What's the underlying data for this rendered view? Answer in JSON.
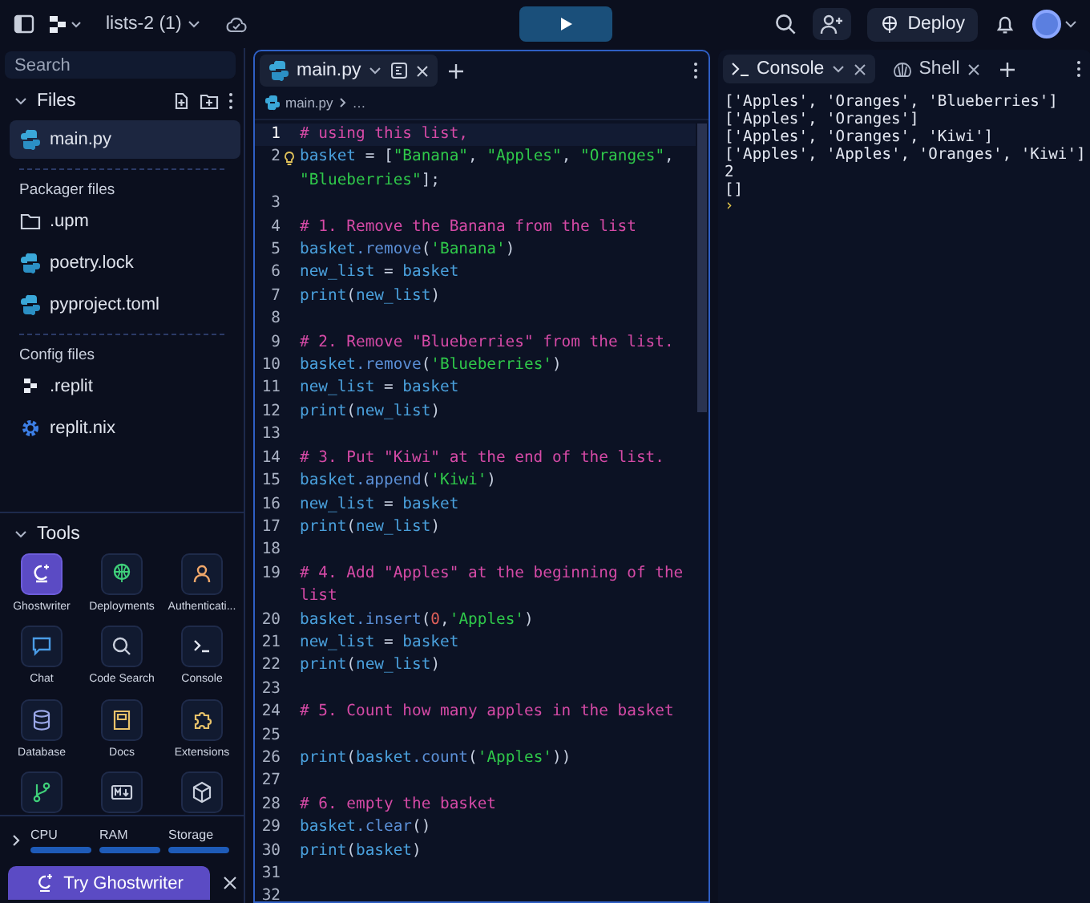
{
  "topbar": {
    "project": "lists-2 (1)",
    "deploy": "Deploy"
  },
  "sidebar": {
    "search": {
      "placeholder": "Search"
    },
    "files_title": "Files",
    "files": [
      {
        "name": "main.py",
        "kind": "python",
        "selected": true
      }
    ],
    "sections": [
      {
        "title": "Packager files",
        "items": [
          {
            "name": ".upm",
            "kind": "folder",
            "selected": false
          },
          {
            "name": "poetry.lock",
            "kind": "python",
            "selected": false
          },
          {
            "name": "pyproject.toml",
            "kind": "python",
            "selected": false
          }
        ]
      },
      {
        "title": "Config files",
        "items": [
          {
            "name": ".replit",
            "kind": "replit",
            "selected": false
          },
          {
            "name": "replit.nix",
            "kind": "gear",
            "selected": false
          }
        ]
      }
    ],
    "tools_title": "Tools",
    "tools": [
      {
        "label": "Ghostwriter",
        "kind": "ghostwriter",
        "selected": true
      },
      {
        "label": "Deployments",
        "kind": "deploy",
        "selected": false
      },
      {
        "label": "Authenticati...",
        "kind": "auth",
        "selected": false
      },
      {
        "label": "Chat",
        "kind": "chat",
        "selected": false
      },
      {
        "label": "Code Search",
        "kind": "search",
        "selected": false
      },
      {
        "label": "Console",
        "kind": "console",
        "selected": false
      },
      {
        "label": "Database",
        "kind": "database",
        "selected": false
      },
      {
        "label": "Docs",
        "kind": "docs",
        "selected": false
      },
      {
        "label": "Extensions",
        "kind": "extensions",
        "selected": false
      },
      {
        "kind": "git",
        "selected": false
      },
      {
        "kind": "markdown",
        "selected": false
      },
      {
        "kind": "package",
        "selected": false
      }
    ],
    "meters": [
      {
        "name": "CPU",
        "level": 1
      },
      {
        "name": "RAM",
        "level": 1
      },
      {
        "name": "Storage",
        "level": 1
      }
    ],
    "try_button": "Try Ghostwriter"
  },
  "editor": {
    "tab": "main.py",
    "breadcrumb": "main.py",
    "breadcrumb_more": "…",
    "lines": [
      {
        "number": "1",
        "current": true,
        "tokens": [
          {
            "kind": "comment",
            "text": "# using this list,"
          }
        ]
      },
      {
        "number": "2",
        "current": false,
        "tokens": [
          {
            "kind": "ident",
            "text": "basket"
          },
          {
            "kind": "punct",
            "text": " = ["
          },
          {
            "kind": "string",
            "text": "\"Banana\""
          },
          {
            "kind": "punct",
            "text": ", "
          },
          {
            "kind": "string",
            "text": "\"Apples\""
          },
          {
            "kind": "punct",
            "text": ", "
          },
          {
            "kind": "string",
            "text": "\"Oranges\""
          },
          {
            "kind": "punct",
            "text": ", "
          },
          {
            "kind": "string",
            "text": "\"Blueberries\""
          },
          {
            "kind": "punct",
            "text": "];"
          }
        ]
      },
      {
        "number": "3",
        "current": false
      },
      {
        "number": "4",
        "current": false,
        "tokens": [
          {
            "kind": "comment",
            "text": "# 1. Remove the Banana from the list"
          }
        ]
      },
      {
        "number": "5",
        "current": false,
        "tokens": [
          {
            "kind": "ident",
            "text": "basket"
          },
          {
            "kind": "method",
            "text": ".remove"
          },
          {
            "kind": "punct",
            "text": "("
          },
          {
            "kind": "string",
            "text": "'Banana'"
          },
          {
            "kind": "punct",
            "text": ")"
          }
        ]
      },
      {
        "number": "6",
        "current": false,
        "tokens": [
          {
            "kind": "ident",
            "text": "new_list"
          },
          {
            "kind": "punct",
            "text": " = "
          },
          {
            "kind": "ident",
            "text": "basket"
          }
        ]
      },
      {
        "number": "7",
        "current": false,
        "tokens": [
          {
            "kind": "ident",
            "text": "print"
          },
          {
            "kind": "punct",
            "text": "("
          },
          {
            "kind": "ident",
            "text": "new_list"
          },
          {
            "kind": "punct",
            "text": ")"
          }
        ]
      },
      {
        "number": "8",
        "current": false
      },
      {
        "number": "9",
        "current": false,
        "tokens": [
          {
            "kind": "comment",
            "text": "# 2. Remove \"Blueberries\" from the list."
          }
        ]
      },
      {
        "number": "10",
        "current": false,
        "tokens": [
          {
            "kind": "ident",
            "text": "basket"
          },
          {
            "kind": "method",
            "text": ".remove"
          },
          {
            "kind": "punct",
            "text": "("
          },
          {
            "kind": "string",
            "text": "'Blueberries'"
          },
          {
            "kind": "punct",
            "text": ")"
          }
        ]
      },
      {
        "number": "11",
        "current": false,
        "tokens": [
          {
            "kind": "ident",
            "text": "new_list"
          },
          {
            "kind": "punct",
            "text": " = "
          },
          {
            "kind": "ident",
            "text": "basket"
          }
        ]
      },
      {
        "number": "12",
        "current": false,
        "tokens": [
          {
            "kind": "ident",
            "text": "print"
          },
          {
            "kind": "punct",
            "text": "("
          },
          {
            "kind": "ident",
            "text": "new_list"
          },
          {
            "kind": "punct",
            "text": ")"
          }
        ]
      },
      {
        "number": "13",
        "current": false
      },
      {
        "number": "14",
        "current": false,
        "tokens": [
          {
            "kind": "comment",
            "text": "# 3. Put \"Kiwi\" at the end of the list."
          }
        ]
      },
      {
        "number": "15",
        "current": false,
        "tokens": [
          {
            "kind": "ident",
            "text": "basket"
          },
          {
            "kind": "method",
            "text": ".append"
          },
          {
            "kind": "punct",
            "text": "("
          },
          {
            "kind": "string",
            "text": "'Kiwi'"
          },
          {
            "kind": "punct",
            "text": ")"
          }
        ]
      },
      {
        "number": "16",
        "current": false,
        "tokens": [
          {
            "kind": "ident",
            "text": "new_list"
          },
          {
            "kind": "punct",
            "text": " = "
          },
          {
            "kind": "ident",
            "text": "basket"
          }
        ]
      },
      {
        "number": "17",
        "current": false,
        "tokens": [
          {
            "kind": "ident",
            "text": "print"
          },
          {
            "kind": "punct",
            "text": "("
          },
          {
            "kind": "ident",
            "text": "new_list"
          },
          {
            "kind": "punct",
            "text": ")"
          }
        ]
      },
      {
        "number": "18",
        "current": false
      },
      {
        "number": "19",
        "current": false,
        "tokens": [
          {
            "kind": "comment",
            "text": "# 4. Add \"Apples\" at the beginning of the list"
          }
        ]
      },
      {
        "number": "20",
        "current": false,
        "tokens": [
          {
            "kind": "ident",
            "text": "basket"
          },
          {
            "kind": "method",
            "text": ".insert"
          },
          {
            "kind": "punct",
            "text": "("
          },
          {
            "kind": "number",
            "text": "0"
          },
          {
            "kind": "punct",
            "text": ","
          },
          {
            "kind": "string",
            "text": "'Apples'"
          },
          {
            "kind": "punct",
            "text": ")"
          }
        ]
      },
      {
        "number": "21",
        "current": false,
        "tokens": [
          {
            "kind": "ident",
            "text": "new_list"
          },
          {
            "kind": "punct",
            "text": " = "
          },
          {
            "kind": "ident",
            "text": "basket"
          }
        ]
      },
      {
        "number": "22",
        "current": false,
        "tokens": [
          {
            "kind": "ident",
            "text": "print"
          },
          {
            "kind": "punct",
            "text": "("
          },
          {
            "kind": "ident",
            "text": "new_list"
          },
          {
            "kind": "punct",
            "text": ")"
          }
        ]
      },
      {
        "number": "23",
        "current": false
      },
      {
        "number": "24",
        "current": false,
        "tokens": [
          {
            "kind": "comment",
            "text": "# 5. Count how many apples in the basket"
          }
        ]
      },
      {
        "number": "25",
        "current": false
      },
      {
        "number": "26",
        "current": false,
        "tokens": [
          {
            "kind": "ident",
            "text": "print"
          },
          {
            "kind": "punct",
            "text": "("
          },
          {
            "kind": "ident",
            "text": "basket"
          },
          {
            "kind": "method",
            "text": ".count"
          },
          {
            "kind": "punct",
            "text": "("
          },
          {
            "kind": "string",
            "text": "'Apples'"
          },
          {
            "kind": "punct",
            "text": "))"
          }
        ]
      },
      {
        "number": "27",
        "current": false
      },
      {
        "number": "28",
        "current": false,
        "tokens": [
          {
            "kind": "comment",
            "text": "# 6. empty the basket"
          }
        ]
      },
      {
        "number": "29",
        "current": false,
        "tokens": [
          {
            "kind": "ident",
            "text": "basket"
          },
          {
            "kind": "method",
            "text": ".clear"
          },
          {
            "kind": "punct",
            "text": "()"
          }
        ]
      },
      {
        "number": "30",
        "current": false,
        "tokens": [
          {
            "kind": "ident",
            "text": "print"
          },
          {
            "kind": "punct",
            "text": "("
          },
          {
            "kind": "ident",
            "text": "basket"
          },
          {
            "kind": "punct",
            "text": ")"
          }
        ]
      },
      {
        "number": "31",
        "current": false
      },
      {
        "number": "32",
        "current": false
      }
    ]
  },
  "console": {
    "tabs": [
      {
        "label": "Console",
        "kind": "console",
        "selected": true
      },
      {
        "label": "Shell",
        "kind": "shell",
        "selected": false
      }
    ],
    "output": [
      "['Apples', 'Oranges', 'Blueberries']",
      "['Apples', 'Oranges']",
      "['Apples', 'Oranges', 'Kiwi']",
      "['Apples', 'Apples', 'Oranges', 'Kiwi']",
      "2",
      "[]"
    ],
    "prompt": "›"
  }
}
